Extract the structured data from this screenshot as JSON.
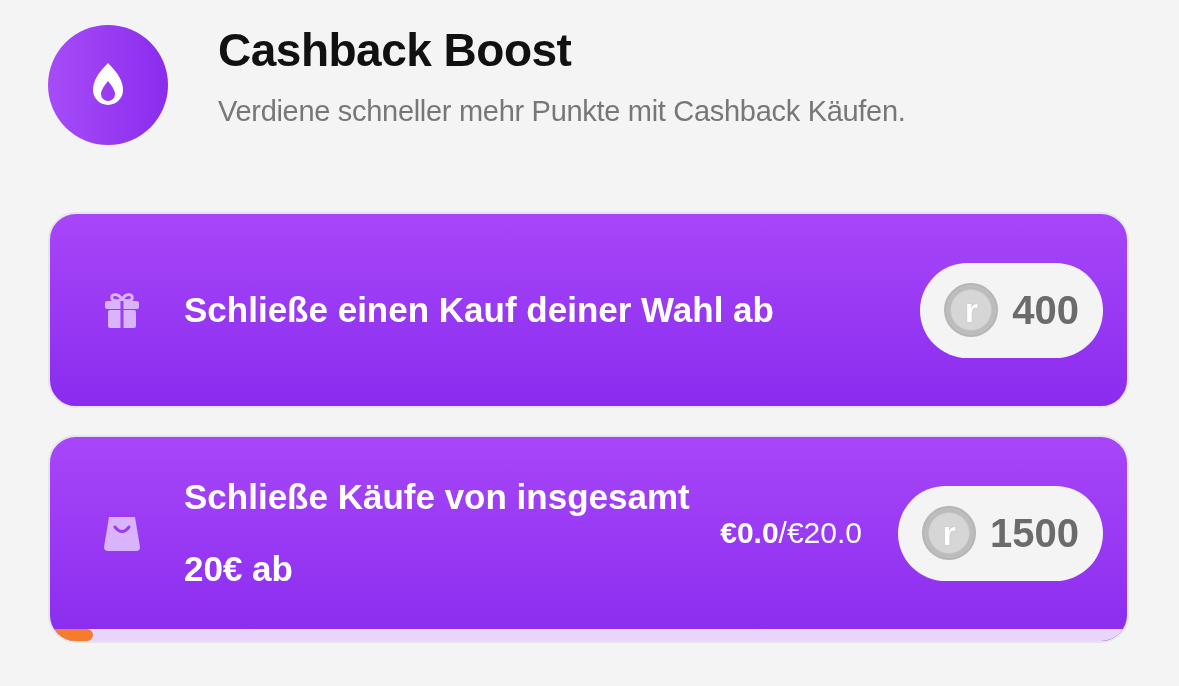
{
  "header": {
    "title": "Cashback Boost",
    "subtitle": "Verdiene schneller mehr Punkte mit Cashback Käufen."
  },
  "tasks": [
    {
      "kind": "gift",
      "title": "Schließe einen Kauf deiner Wahl ab",
      "reward": "400",
      "coin_letter": "r"
    },
    {
      "kind": "bag",
      "title": "Schließe Käufe von insgesamt 20€ ab",
      "progress_text": "**€0.0**/€20.0",
      "reward": "1500",
      "coin_letter": "r",
      "level": 0.04
    }
  ]
}
